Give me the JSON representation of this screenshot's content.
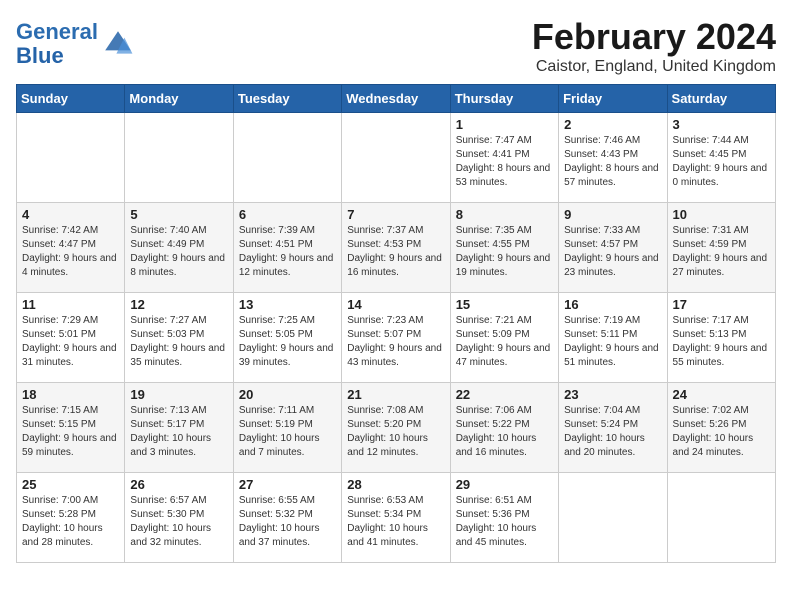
{
  "header": {
    "logo_line1": "General",
    "logo_line2": "Blue",
    "month_year": "February 2024",
    "location": "Caistor, England, United Kingdom"
  },
  "weekdays": [
    "Sunday",
    "Monday",
    "Tuesday",
    "Wednesday",
    "Thursday",
    "Friday",
    "Saturday"
  ],
  "weeks": [
    [
      {
        "day": "",
        "sunrise": "",
        "sunset": "",
        "daylight": ""
      },
      {
        "day": "",
        "sunrise": "",
        "sunset": "",
        "daylight": ""
      },
      {
        "day": "",
        "sunrise": "",
        "sunset": "",
        "daylight": ""
      },
      {
        "day": "",
        "sunrise": "",
        "sunset": "",
        "daylight": ""
      },
      {
        "day": "1",
        "sunrise": "Sunrise: 7:47 AM",
        "sunset": "Sunset: 4:41 PM",
        "daylight": "Daylight: 8 hours and 53 minutes."
      },
      {
        "day": "2",
        "sunrise": "Sunrise: 7:46 AM",
        "sunset": "Sunset: 4:43 PM",
        "daylight": "Daylight: 8 hours and 57 minutes."
      },
      {
        "day": "3",
        "sunrise": "Sunrise: 7:44 AM",
        "sunset": "Sunset: 4:45 PM",
        "daylight": "Daylight: 9 hours and 0 minutes."
      }
    ],
    [
      {
        "day": "4",
        "sunrise": "Sunrise: 7:42 AM",
        "sunset": "Sunset: 4:47 PM",
        "daylight": "Daylight: 9 hours and 4 minutes."
      },
      {
        "day": "5",
        "sunrise": "Sunrise: 7:40 AM",
        "sunset": "Sunset: 4:49 PM",
        "daylight": "Daylight: 9 hours and 8 minutes."
      },
      {
        "day": "6",
        "sunrise": "Sunrise: 7:39 AM",
        "sunset": "Sunset: 4:51 PM",
        "daylight": "Daylight: 9 hours and 12 minutes."
      },
      {
        "day": "7",
        "sunrise": "Sunrise: 7:37 AM",
        "sunset": "Sunset: 4:53 PM",
        "daylight": "Daylight: 9 hours and 16 minutes."
      },
      {
        "day": "8",
        "sunrise": "Sunrise: 7:35 AM",
        "sunset": "Sunset: 4:55 PM",
        "daylight": "Daylight: 9 hours and 19 minutes."
      },
      {
        "day": "9",
        "sunrise": "Sunrise: 7:33 AM",
        "sunset": "Sunset: 4:57 PM",
        "daylight": "Daylight: 9 hours and 23 minutes."
      },
      {
        "day": "10",
        "sunrise": "Sunrise: 7:31 AM",
        "sunset": "Sunset: 4:59 PM",
        "daylight": "Daylight: 9 hours and 27 minutes."
      }
    ],
    [
      {
        "day": "11",
        "sunrise": "Sunrise: 7:29 AM",
        "sunset": "Sunset: 5:01 PM",
        "daylight": "Daylight: 9 hours and 31 minutes."
      },
      {
        "day": "12",
        "sunrise": "Sunrise: 7:27 AM",
        "sunset": "Sunset: 5:03 PM",
        "daylight": "Daylight: 9 hours and 35 minutes."
      },
      {
        "day": "13",
        "sunrise": "Sunrise: 7:25 AM",
        "sunset": "Sunset: 5:05 PM",
        "daylight": "Daylight: 9 hours and 39 minutes."
      },
      {
        "day": "14",
        "sunrise": "Sunrise: 7:23 AM",
        "sunset": "Sunset: 5:07 PM",
        "daylight": "Daylight: 9 hours and 43 minutes."
      },
      {
        "day": "15",
        "sunrise": "Sunrise: 7:21 AM",
        "sunset": "Sunset: 5:09 PM",
        "daylight": "Daylight: 9 hours and 47 minutes."
      },
      {
        "day": "16",
        "sunrise": "Sunrise: 7:19 AM",
        "sunset": "Sunset: 5:11 PM",
        "daylight": "Daylight: 9 hours and 51 minutes."
      },
      {
        "day": "17",
        "sunrise": "Sunrise: 7:17 AM",
        "sunset": "Sunset: 5:13 PM",
        "daylight": "Daylight: 9 hours and 55 minutes."
      }
    ],
    [
      {
        "day": "18",
        "sunrise": "Sunrise: 7:15 AM",
        "sunset": "Sunset: 5:15 PM",
        "daylight": "Daylight: 9 hours and 59 minutes."
      },
      {
        "day": "19",
        "sunrise": "Sunrise: 7:13 AM",
        "sunset": "Sunset: 5:17 PM",
        "daylight": "Daylight: 10 hours and 3 minutes."
      },
      {
        "day": "20",
        "sunrise": "Sunrise: 7:11 AM",
        "sunset": "Sunset: 5:19 PM",
        "daylight": "Daylight: 10 hours and 7 minutes."
      },
      {
        "day": "21",
        "sunrise": "Sunrise: 7:08 AM",
        "sunset": "Sunset: 5:20 PM",
        "daylight": "Daylight: 10 hours and 12 minutes."
      },
      {
        "day": "22",
        "sunrise": "Sunrise: 7:06 AM",
        "sunset": "Sunset: 5:22 PM",
        "daylight": "Daylight: 10 hours and 16 minutes."
      },
      {
        "day": "23",
        "sunrise": "Sunrise: 7:04 AM",
        "sunset": "Sunset: 5:24 PM",
        "daylight": "Daylight: 10 hours and 20 minutes."
      },
      {
        "day": "24",
        "sunrise": "Sunrise: 7:02 AM",
        "sunset": "Sunset: 5:26 PM",
        "daylight": "Daylight: 10 hours and 24 minutes."
      }
    ],
    [
      {
        "day": "25",
        "sunrise": "Sunrise: 7:00 AM",
        "sunset": "Sunset: 5:28 PM",
        "daylight": "Daylight: 10 hours and 28 minutes."
      },
      {
        "day": "26",
        "sunrise": "Sunrise: 6:57 AM",
        "sunset": "Sunset: 5:30 PM",
        "daylight": "Daylight: 10 hours and 32 minutes."
      },
      {
        "day": "27",
        "sunrise": "Sunrise: 6:55 AM",
        "sunset": "Sunset: 5:32 PM",
        "daylight": "Daylight: 10 hours and 37 minutes."
      },
      {
        "day": "28",
        "sunrise": "Sunrise: 6:53 AM",
        "sunset": "Sunset: 5:34 PM",
        "daylight": "Daylight: 10 hours and 41 minutes."
      },
      {
        "day": "29",
        "sunrise": "Sunrise: 6:51 AM",
        "sunset": "Sunset: 5:36 PM",
        "daylight": "Daylight: 10 hours and 45 minutes."
      },
      {
        "day": "",
        "sunrise": "",
        "sunset": "",
        "daylight": ""
      },
      {
        "day": "",
        "sunrise": "",
        "sunset": "",
        "daylight": ""
      }
    ]
  ]
}
